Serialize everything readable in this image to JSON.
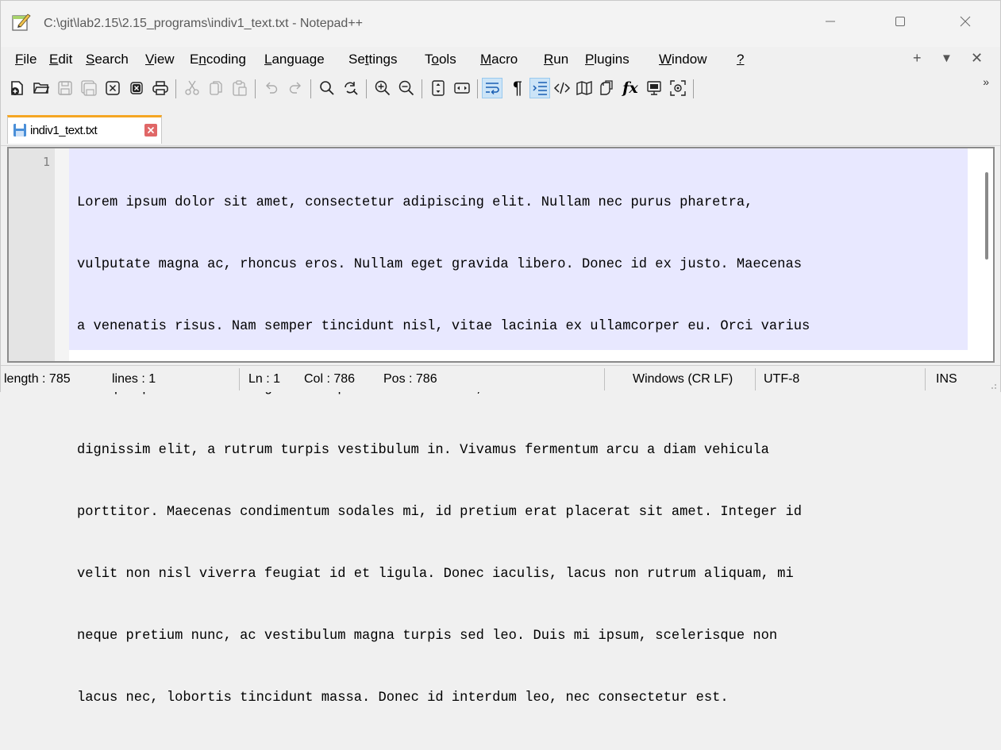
{
  "window": {
    "title": "C:\\git\\lab2.15\\2.15_programs\\indiv1_text.txt - Notepad++",
    "minimize_icon": "minimize-icon",
    "maximize_icon": "maximize-icon",
    "close_icon": "close-icon"
  },
  "menu": {
    "items": [
      {
        "label": "File",
        "access": "F"
      },
      {
        "label": "Edit",
        "access": "E"
      },
      {
        "label": "Search",
        "access": "S"
      },
      {
        "label": "View",
        "access": "V"
      },
      {
        "label": "Encoding",
        "access": "n"
      },
      {
        "label": "Language",
        "access": "L"
      },
      {
        "label": "Settings",
        "access": "t"
      },
      {
        "label": "Tools",
        "access": "o"
      },
      {
        "label": "Macro",
        "access": "M"
      },
      {
        "label": "Run",
        "access": "R"
      },
      {
        "label": "Plugins",
        "access": "P"
      },
      {
        "label": "Window",
        "access": "W"
      },
      {
        "label": "?",
        "access": "?"
      }
    ],
    "right": {
      "plus": "+",
      "down": "▼",
      "close": "✕"
    }
  },
  "toolbar": {
    "buttons": [
      "new-file-icon",
      "open-file-icon",
      "save-icon",
      "save-all-icon",
      "close-icon",
      "close-all-icon",
      "print-icon",
      "cut-icon",
      "copy-icon",
      "paste-icon",
      "undo-icon",
      "redo-icon",
      "find-icon",
      "replace-icon",
      "zoom-in-icon",
      "zoom-out-icon",
      "sync-vertical-icon",
      "sync-horizontal-icon",
      "word-wrap-icon",
      "show-all-chars-icon",
      "indent-guide-icon",
      "xml-tag-icon",
      "document-map-icon",
      "doc-list-icon",
      "function-list-icon",
      "folder-as-workspace-icon",
      "monitoring-icon"
    ],
    "active": [
      "word-wrap-icon",
      "indent-guide-icon"
    ],
    "more": "»",
    "function_symbol": "fx",
    "pilcrow": "¶"
  },
  "tab": {
    "label": "indiv1_text.txt",
    "close": "✕"
  },
  "editor": {
    "line_number": "1",
    "lines": [
      "Lorem ipsum dolor sit amet, consectetur adipiscing elit. Nullam nec purus pharetra,",
      "vulputate magna ac, rhoncus eros. Nullam eget gravida libero. Donec id ex justo. Maecenas",
      "a venenatis risus. Nam semper tincidunt nisl, vitae lacinia ex ullamcorper eu. Orci varius",
      "natoque penatibus et magnis dis parturient montes, nascetur ridiculus mus. Etiam ornare",
      "dignissim elit, a rutrum turpis vestibulum in. Vivamus fermentum arcu a diam vehicula",
      "porttitor. Maecenas condimentum sodales mi, id pretium erat placerat sit amet. Integer id",
      "velit non nisl viverra feugiat id et ligula. Donec iaculis, lacus non rutrum aliquam, mi",
      "neque pretium nunc, ac vestibulum magna turpis sed leo. Duis mi ipsum, scelerisque non",
      "lacus nec, lobortis tincidunt massa. Donec id interdum leo, nec consectetur est."
    ]
  },
  "status": {
    "length": "length : 785",
    "lines": "lines : 1",
    "ln": "Ln : 1",
    "col": "Col : 786",
    "pos": "Pos : 786",
    "eol": "Windows (CR LF)",
    "encoding": "UTF-8",
    "mode": "INS"
  },
  "colors": {
    "selection_bg": "#e8e8ff",
    "tab_accent": "#f5a623",
    "tab_close": "#e06767",
    "active_button_bg": "#cce4f7"
  }
}
